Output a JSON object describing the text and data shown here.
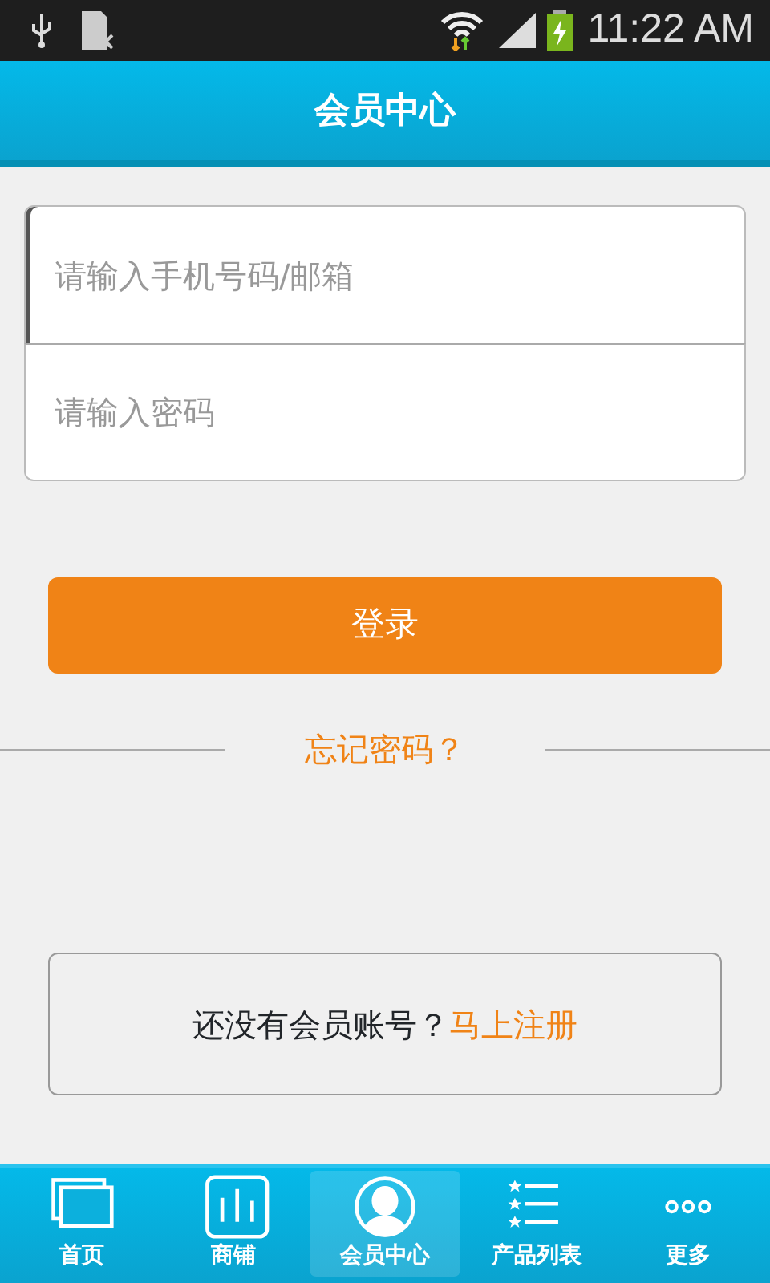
{
  "status_bar": {
    "time": "11:22 AM"
  },
  "header": {
    "title": "会员中心"
  },
  "form": {
    "fields": [
      {
        "placeholder": "请输入手机号码/邮箱",
        "focused": true
      },
      {
        "placeholder": "请输入密码",
        "focused": false
      }
    ]
  },
  "login_button": "登录",
  "forgot_link": "忘记密码？",
  "register": {
    "text": "还没有会员账号？",
    "link": "马上注册"
  },
  "tabs": [
    {
      "label": "首页",
      "selected": false
    },
    {
      "label": "商铺",
      "selected": false
    },
    {
      "label": "会员中心",
      "selected": true
    },
    {
      "label": "产品列表",
      "selected": false
    },
    {
      "label": "更多",
      "selected": false
    }
  ]
}
